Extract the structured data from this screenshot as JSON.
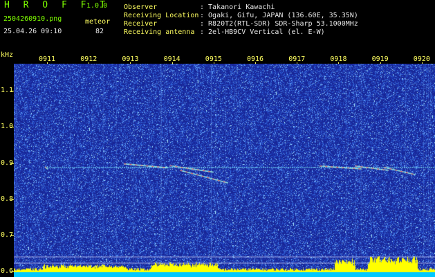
{
  "header": {
    "brand": "H R O F F T",
    "version": "1.0.0",
    "filename": "2504260910.png",
    "datetime": "25.04.26 09:10",
    "meteor_label": "meteor",
    "meteor_count": "82",
    "observer_label": "Observer",
    "observer_value": ": Takanori Kawachi",
    "location_label": "Receiving Location",
    "location_value": ": Ogaki, Gifu, JAPAN (136.60E, 35.35N)",
    "receiver_label": "Receiver",
    "receiver_value": ": R820T2(RTL-SDR) SDR-Sharp 53.1000MHz",
    "antenna_label": "Receiving antenna",
    "antenna_value": ": 2el-HB9CV Vertical (el. E-W)"
  },
  "axis": {
    "unit": "kHz",
    "yticks": [
      {
        "label": "1.1",
        "value": 1.1
      },
      {
        "label": "1.0",
        "value": 1.0
      },
      {
        "label": "0.9",
        "value": 0.9
      },
      {
        "label": "0.8",
        "value": 0.8
      },
      {
        "label": "0.7",
        "value": 0.7
      },
      {
        "label": "0.6",
        "value": 0.6
      }
    ],
    "ylim": [
      0.585,
      1.175
    ],
    "xticks": [
      {
        "label": "0911",
        "value": 911
      },
      {
        "label": "0912",
        "value": 912
      },
      {
        "label": "0913",
        "value": 913
      },
      {
        "label": "0914",
        "value": 914
      },
      {
        "label": "0915",
        "value": 915
      },
      {
        "label": "0916",
        "value": 916
      },
      {
        "label": "0917",
        "value": 917
      },
      {
        "label": "0918",
        "value": 918
      },
      {
        "label": "0919",
        "value": 919
      },
      {
        "label": "0920",
        "value": 920
      }
    ]
  },
  "colors": {
    "background": "#000000",
    "spectrum_bg": "#1a2a9a",
    "noise": "#6fa8ff",
    "carrier": "#7ff0ff",
    "meteor_trace": "#ff5050",
    "signal_bar": "#ffff00",
    "baseline_band": "#00c8ff",
    "label": "#ffff60"
  },
  "signals": {
    "carrier_khz": 0.888,
    "echoes": [
      {
        "t0": 910.95,
        "f0": 0.89,
        "t1": 911.02,
        "f1": 0.883
      },
      {
        "t0": 912.85,
        "f0": 0.898,
        "t1": 913.9,
        "f1": 0.887
      },
      {
        "t0": 913.95,
        "f0": 0.893,
        "t1": 915.0,
        "f1": 0.875
      },
      {
        "t0": 914.2,
        "f0": 0.88,
        "t1": 915.35,
        "f1": 0.845
      },
      {
        "t0": 917.55,
        "f0": 0.892,
        "t1": 918.55,
        "f1": 0.884
      },
      {
        "t0": 918.4,
        "f0": 0.892,
        "t1": 919.2,
        "f1": 0.88
      },
      {
        "t0": 919.1,
        "f0": 0.888,
        "t1": 919.85,
        "f1": 0.868
      }
    ]
  }
}
